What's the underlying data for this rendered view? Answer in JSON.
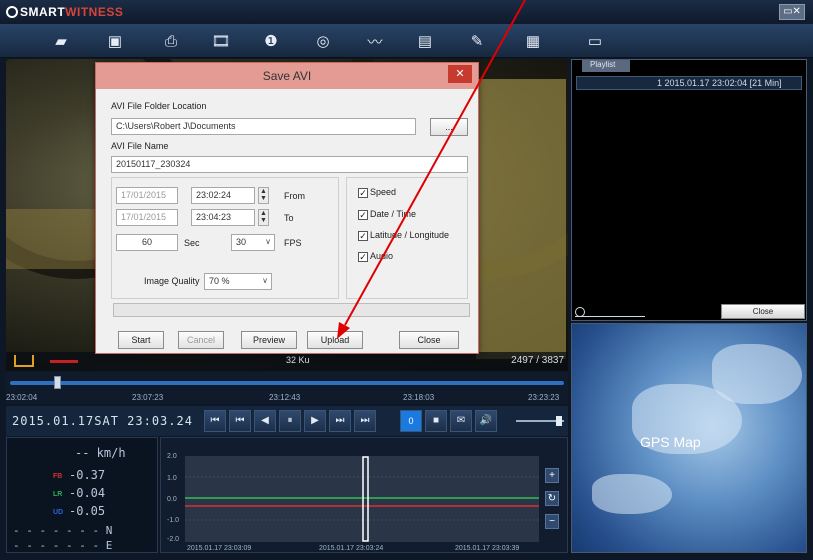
{
  "app": {
    "logo_main": "SMART",
    "logo_secondary": "WITNESS",
    "window_controls": "▭✕"
  },
  "toolbar": {
    "icons": [
      "folder-open-icon",
      "camera-icon",
      "printer-icon",
      "video-clip-icon",
      "info-icon",
      "globe-icon",
      "waveform-icon",
      "document-icon",
      "wrench-icon",
      "screen-icon",
      "chat-icon"
    ]
  },
  "video": {
    "time_counter": "2497 / 3837",
    "mid_label": "32 Ku"
  },
  "dialog": {
    "title": "Save AVI",
    "close_symbol": "✕",
    "folder_label": "AVI File Folder Location",
    "folder_value": "C:\\Users\\Robert J\\Documents",
    "browse_label": "...",
    "name_label": "AVI File Name",
    "name_value": "20150117_230324",
    "from_date": "17/01/2015",
    "from_time": "23:02:24",
    "from_label": "From",
    "to_date": "17/01/2015",
    "to_time": "23:04:23",
    "to_label": "To",
    "duration_value": "60",
    "sec_label": "Sec",
    "fps_value": "30",
    "fps_label": "FPS",
    "quality_label": "Image Quality",
    "quality_value": "70 %",
    "checkboxes": [
      {
        "label": "Speed",
        "checked": true
      },
      {
        "label": "Date / Time",
        "checked": true
      },
      {
        "label": "Latitude / Longitude",
        "checked": true
      },
      {
        "label": "Audio",
        "checked": true
      }
    ],
    "buttons": {
      "start": "Start",
      "cancel": "Cancel",
      "preview": "Preview",
      "upload": "Upload",
      "close": "Close"
    }
  },
  "playlist": {
    "tab": "Playlist",
    "items": [
      "1  2015.01.17 23:02:04 [21 Min]"
    ],
    "close_button": "Close"
  },
  "gps": {
    "label": "GPS Map"
  },
  "timeline": {
    "ticks": [
      "23:02:04",
      "23:07:23",
      "23:12:43",
      "23:18:03",
      "23:23:23"
    ],
    "position": 0.08
  },
  "controls": {
    "datetime": "2015.01.17SAT 23:03.24",
    "buttons": [
      "⏮",
      "⏮",
      "◀",
      "⏸",
      "▶",
      "⏭",
      "⏭"
    ],
    "speed_value": "0",
    "extra_buttons": [
      "■",
      "✉",
      "🔊"
    ]
  },
  "telemetry": {
    "speed": "-- km/h",
    "axes": [
      {
        "tag": "FB",
        "value": "-0.37",
        "color": "#d83030"
      },
      {
        "tag": "LR",
        "value": "-0.04",
        "color": "#30b050"
      },
      {
        "tag": "UD",
        "value": "-0.05",
        "color": "#3060e0"
      }
    ],
    "lat": "- - - - - - - N",
    "lon": "- - - - - - - E"
  },
  "graph": {
    "y_ticks": [
      "2.0",
      "1.0",
      "0.0",
      "-1.0",
      "-2.0"
    ],
    "x_ticks": [
      "2015.01.17 23:03:09",
      "2015.01.17 23:03:24",
      "2015.01.17 23:03:39"
    ],
    "series_colors": {
      "lr": "#30c050",
      "fb": "#d83030"
    },
    "side_buttons": [
      "+",
      "↻",
      "−"
    ]
  }
}
